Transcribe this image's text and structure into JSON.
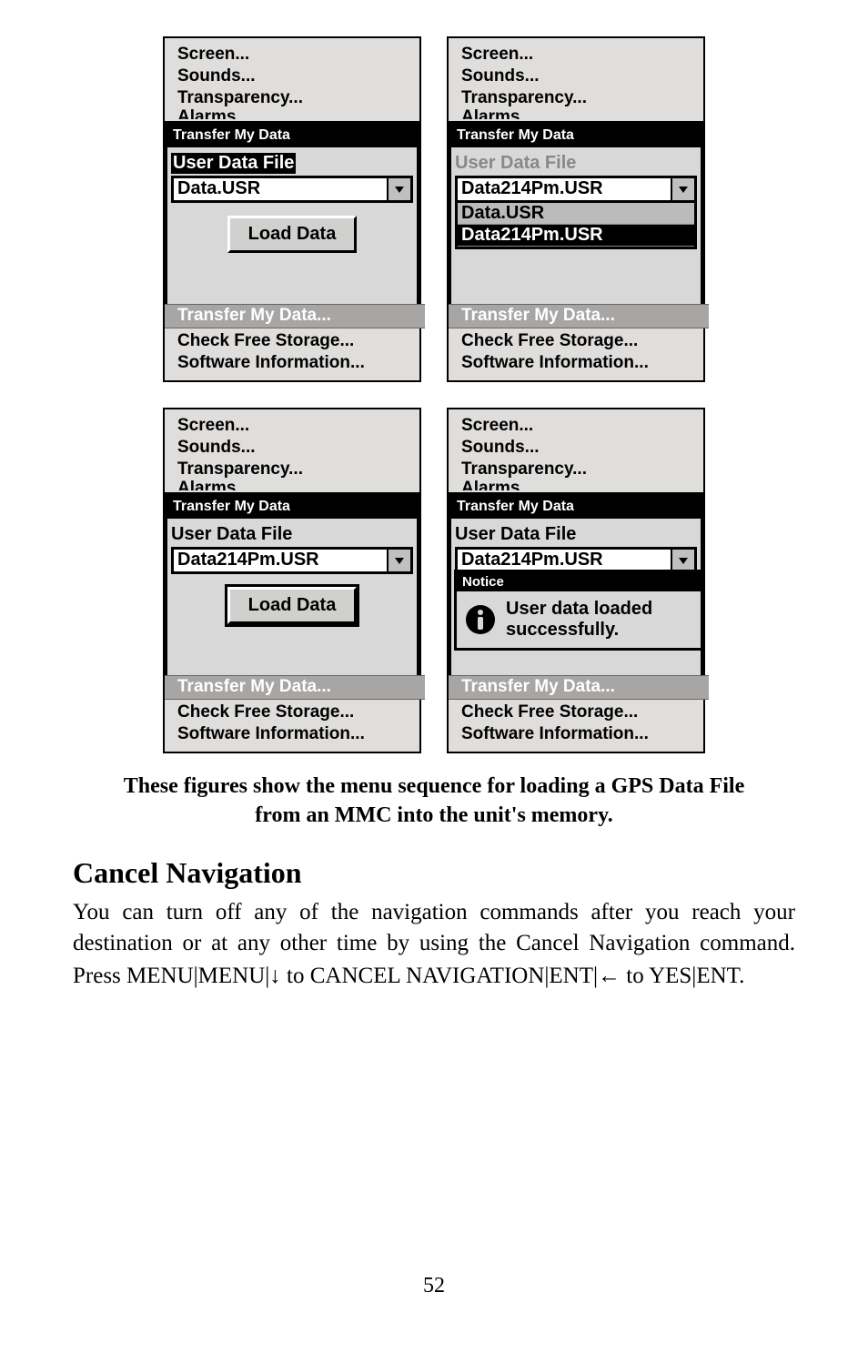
{
  "menu_items_top": [
    "Screen...",
    "Sounds...",
    "Transparency..."
  ],
  "menu_item_clipped": "Alarms",
  "popup_title": "Transfer My Data",
  "field_label": "User Data File",
  "panel1": {
    "combo_value": "Data.USR",
    "button": "Load Data"
  },
  "panel2": {
    "combo_value": "Data214Pm.USR",
    "options": [
      "Data.USR",
      "Data214Pm.USR"
    ]
  },
  "panel3": {
    "combo_value": "Data214Pm.USR",
    "button": "Load Data"
  },
  "panel4": {
    "combo_value": "Data214Pm.USR",
    "notice_title": "Notice",
    "notice_text_1": "User data loaded",
    "notice_text_2": "successfully."
  },
  "menu_bottom": [
    "Transfer My Data...",
    "Check Free Storage...",
    "Software Information..."
  ],
  "caption_line1": "These figures show the menu sequence for loading a GPS Data File",
  "caption_line2": "from an MMC into the unit's memory.",
  "section_heading": "Cancel Navigation",
  "body_p": "You can turn off any of the navigation commands after you reach your destination or at any other time by using the Cancel Navigation command. Press ",
  "kbd_menu": "MENU",
  "kbd_to1": " to ",
  "kbd_cancel": "CANCEL NAVIGATION",
  "kbd_to2": " to ",
  "kbd_yes": "YES",
  "page_number": "52"
}
